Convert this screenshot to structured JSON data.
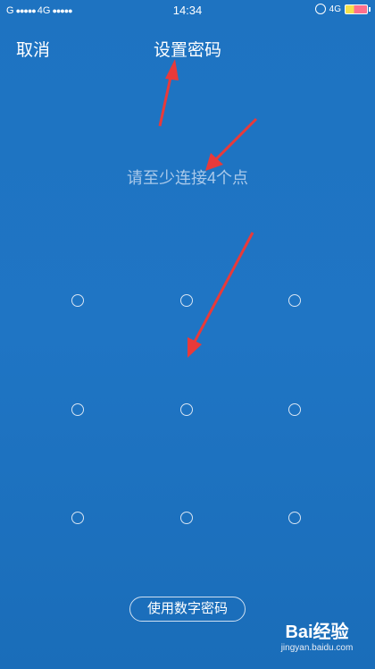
{
  "status_bar": {
    "carrier1": "G",
    "carrier_dots": "●●●●●",
    "network": "4G",
    "carrier2_dots": "●●●●●",
    "time": "14:34",
    "right_network": "4G"
  },
  "nav": {
    "cancel_label": "取消",
    "title": "设置密码"
  },
  "hint": "请至少连接4个点",
  "pattern": {
    "rows": 3,
    "cols": 3
  },
  "pin_button_label": "使用数字密码",
  "watermark": {
    "logo": "Bai经验",
    "url": "jingyan.baidu.com"
  },
  "colors": {
    "background": "#1f74c2",
    "arrow": "#e83a3a",
    "hint": "#a9c9ea"
  }
}
